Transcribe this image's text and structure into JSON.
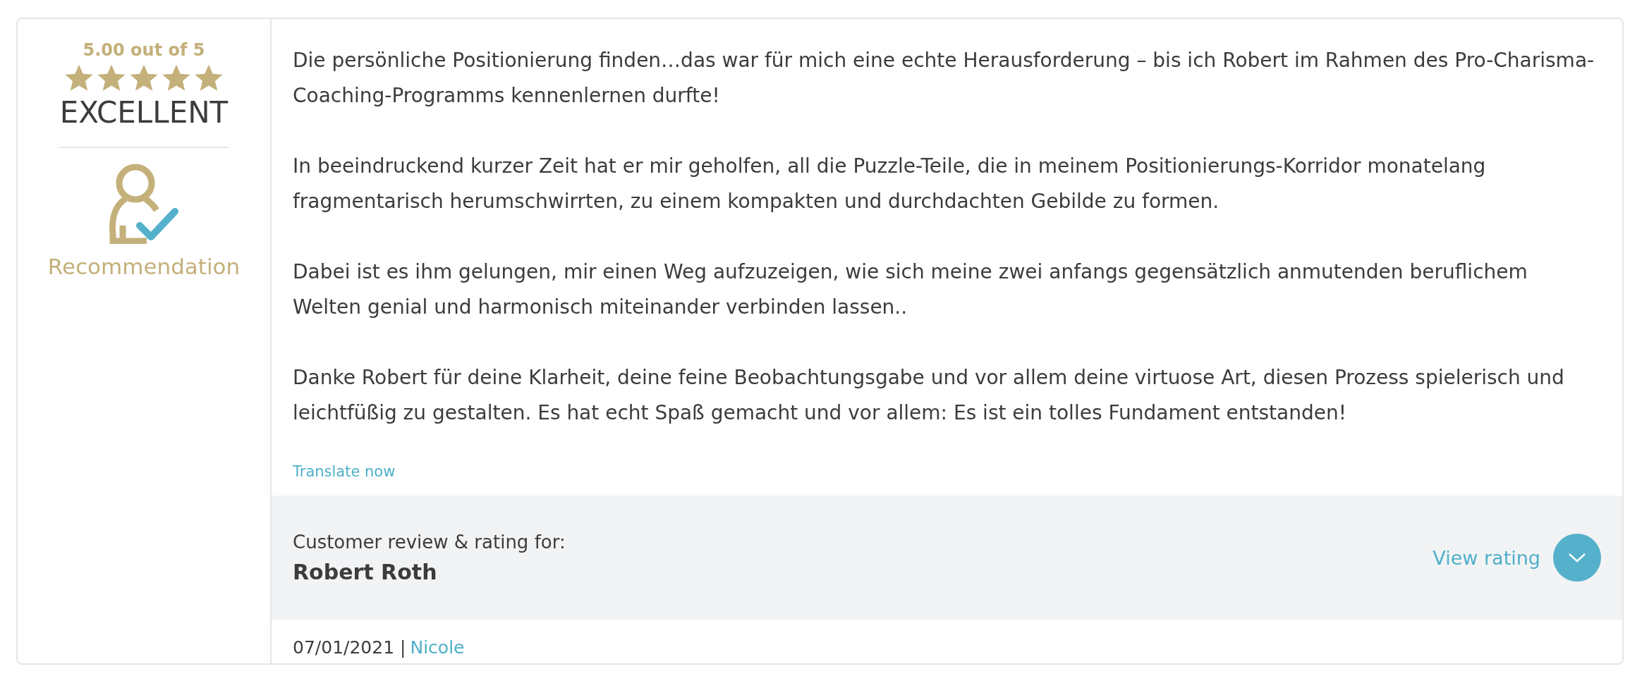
{
  "rating": {
    "score": "5.00 out of 5",
    "stars": 5,
    "verdict": "EXCELLENT",
    "badge": "Recommendation"
  },
  "review": {
    "paragraphs": [
      "Die persönliche Positionierung finden…das war für mich eine echte Herausforderung – bis ich Robert im Rahmen des Pro-Charisma-Coaching-Programms kennenlernen durfte!",
      "In beeindruckend kurzer Zeit hat er mir geholfen, all die Puzzle-Teile, die in meinem Positionierungs-Korridor monatelang fragmentarisch herumschwirrten, zu einem kompakten und durchdachten Gebilde zu formen.",
      "Dabei ist es ihm gelungen, mir einen Weg aufzuzeigen, wie sich meine zwei anfangs gegensätzlich anmutenden beruflichem Welten genial und harmonisch miteinander verbinden lassen..",
      "Danke Robert für deine Klarheit, deine feine Beobachtungsgabe und vor allem deine virtuose Art, diesen Prozess spielerisch und leichtfüßig zu gestalten. Es hat echt Spaß gemacht und vor allem: Es ist ein tolles Fundament entstanden!"
    ],
    "translate_link": "Translate now"
  },
  "subject": {
    "caption": "Customer review & rating for:",
    "name": "Robert Roth",
    "view_link": "View rating",
    "expanded": false
  },
  "footer": {
    "date": "07/01/2021 |",
    "author": "Nicole"
  }
}
